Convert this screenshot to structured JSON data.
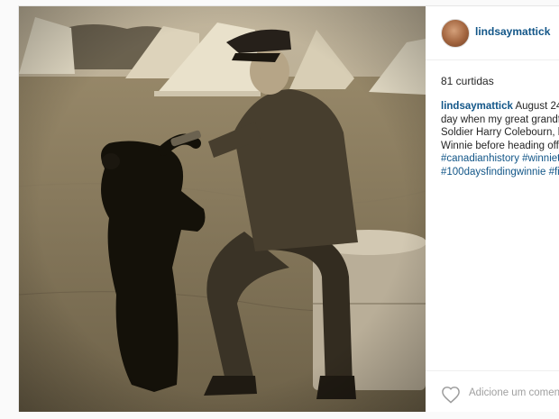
{
  "post": {
    "username": "lindsaymattick",
    "likes_text": "81 curtidas",
    "caption": {
      "username": "lindsaymattick",
      "line1_text": " August 24t",
      "line2_text": "day when my great grandf",
      "line3_text": "Soldier Harry Colebourn, b",
      "line4_text": "Winnie before heading off",
      "hashtags_line1": [
        "#canadianhistory",
        "#winniet"
      ],
      "hashtags_line2": [
        "#100daysfindingwinnie",
        "#fi"
      ]
    },
    "comment_placeholder": "Adicione um comentário..."
  },
  "colors": {
    "link": "#125688",
    "text": "#262626",
    "placeholder": "#a0a0a0"
  },
  "icons": {
    "like": "heart-outline-icon"
  }
}
